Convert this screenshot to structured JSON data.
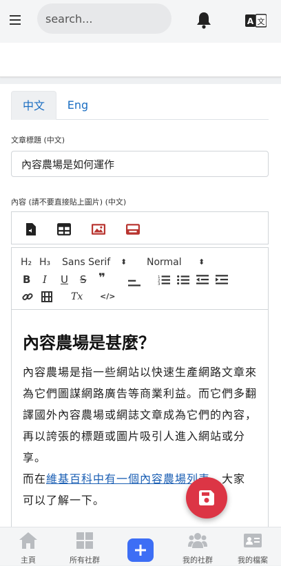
{
  "header": {
    "search_placeholder": "search...",
    "menu_icon": "hamburger-icon",
    "notification_icon": "bell-icon",
    "language_icon": "translate-icon"
  },
  "tabs": [
    {
      "label": "中文",
      "active": true
    },
    {
      "label": "Eng",
      "active": false
    }
  ],
  "form": {
    "title_label": "文章標題 (中文)",
    "title_value": "內容農場是如何運作",
    "content_label": "內容 (請不要直接貼上圖片) (中文)"
  },
  "insert_bar": {
    "buttons": [
      "audio-file-icon",
      "table-icon",
      "image-icon",
      "card-icon"
    ]
  },
  "toolbar": {
    "h2": "H₂",
    "h3": "H₃",
    "font": "Sans Serif",
    "size": "Normal",
    "font_arrow": "⬍",
    "size_arrow": "⬍",
    "bold": "B",
    "italic": "I",
    "underline": "U",
    "strike": "S",
    "quote": "❞",
    "clean": "Tx",
    "code": "</>"
  },
  "editor": {
    "heading": "內容農場是甚麼？",
    "para1": "內容農場是指一些網站以快速生產網路文章來為它們圖謀網路廣告等商業利益。而它們多翻譯國外內容農場或網誌文章成為它們的內容，再以誇張的標題或圖片吸引人進入網站或分享。",
    "para2_prefix": "而在",
    "para2_link": "維基百科中有一個內容農場列表",
    "para2_suffix": "，大家可以了解一下。"
  },
  "colors": {
    "accent": "#1b6ec2",
    "fab": "#dc3545",
    "plus": "#3d6ef5",
    "icon_red": "#b8342f"
  },
  "bottom_nav": [
    {
      "label": "主頁",
      "icon": "home-icon"
    },
    {
      "label": "所有社群",
      "icon": "grid-icon"
    },
    {
      "label": "",
      "icon": "plus-icon"
    },
    {
      "label": "我的社群",
      "icon": "people-icon"
    },
    {
      "label": "我的檔案",
      "icon": "id-card-icon"
    }
  ]
}
